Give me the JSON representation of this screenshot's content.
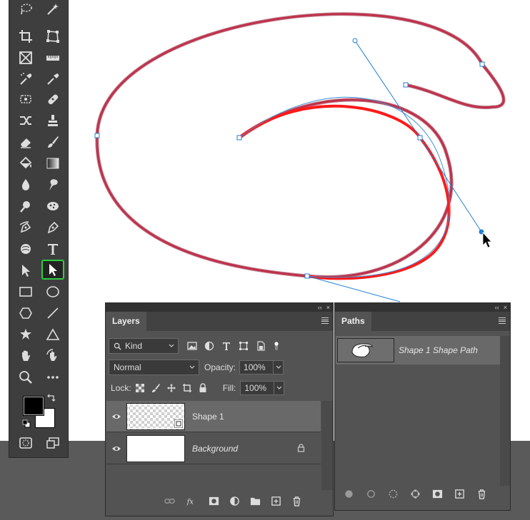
{
  "app": "Photoshop",
  "toolbar": {
    "tools": [
      {
        "id": "lasso",
        "icon": "lasso-icon"
      },
      {
        "id": "magic-wand",
        "icon": "magic-wand-icon"
      },
      {
        "id": "crop",
        "icon": "crop-icon"
      },
      {
        "id": "perspective-crop",
        "icon": "perspective-crop-icon"
      },
      {
        "id": "frame",
        "icon": "frame-icon"
      },
      {
        "id": "ruler",
        "icon": "ruler-icon"
      },
      {
        "id": "eyedropper",
        "icon": "eyedropper-icon"
      },
      {
        "id": "color-sampler",
        "icon": "color-sampler-icon"
      },
      {
        "id": "spot-healing",
        "icon": "spot-healing-icon"
      },
      {
        "id": "bandage",
        "icon": "bandage-icon"
      },
      {
        "id": "content-aware-move",
        "icon": "content-aware-move-icon"
      },
      {
        "id": "clone-stamp",
        "icon": "clone-stamp-icon"
      },
      {
        "id": "eraser",
        "icon": "eraser-icon"
      },
      {
        "id": "brush",
        "icon": "brush-icon"
      },
      {
        "id": "paint-bucket",
        "icon": "paint-bucket-icon"
      },
      {
        "id": "gradient",
        "icon": "gradient-icon"
      },
      {
        "id": "blur",
        "icon": "blur-icon"
      },
      {
        "id": "smudge",
        "icon": "smudge-icon"
      },
      {
        "id": "dodge",
        "icon": "dodge-icon"
      },
      {
        "id": "sponge",
        "icon": "sponge-icon"
      },
      {
        "id": "curvature-pen",
        "icon": "curvature-pen-icon"
      },
      {
        "id": "pen",
        "icon": "pen-icon"
      },
      {
        "id": "mixer-brush",
        "icon": "mixer-brush-icon"
      },
      {
        "id": "type",
        "icon": "type-icon"
      },
      {
        "id": "path-selection",
        "icon": "path-selection-icon"
      },
      {
        "id": "direct-selection",
        "icon": "direct-selection-icon",
        "active": true
      },
      {
        "id": "rectangle",
        "icon": "rectangle-icon"
      },
      {
        "id": "ellipse",
        "icon": "ellipse-icon"
      },
      {
        "id": "polygon",
        "icon": "polygon-icon"
      },
      {
        "id": "line",
        "icon": "line-icon"
      },
      {
        "id": "custom-shape",
        "icon": "custom-shape-icon"
      },
      {
        "id": "triangle",
        "icon": "triangle-icon"
      },
      {
        "id": "hand",
        "icon": "hand-icon"
      },
      {
        "id": "rotate-view",
        "icon": "rotate-view-icon"
      },
      {
        "id": "zoom",
        "icon": "zoom-icon"
      },
      {
        "id": "more-tools",
        "icon": "more-tools-icon"
      }
    ],
    "foreground_color": "#000000",
    "background_color": "#ffffff"
  },
  "canvas": {
    "path_color": "#c0304a",
    "selected_segment_color": "#ff1a1a",
    "handle_color": "#1f7fd4"
  },
  "layers_panel": {
    "tab": "Layers",
    "filter_kind": "Kind",
    "blend_mode": "Normal",
    "opacity_label": "Opacity:",
    "opacity_value": "100%",
    "lock_label": "Lock:",
    "fill_label": "Fill:",
    "fill_value": "100%",
    "layers": [
      {
        "name": "Shape 1",
        "selected": true,
        "visible": true
      },
      {
        "name": "Background",
        "selected": false,
        "visible": true,
        "locked": true
      }
    ]
  },
  "paths_panel": {
    "tab": "Paths",
    "paths": [
      {
        "name": "Shape 1 Shape Path",
        "selected": true
      }
    ]
  },
  "panel_collapse_glyph": "‹‹",
  "panel_close_glyph": "×"
}
